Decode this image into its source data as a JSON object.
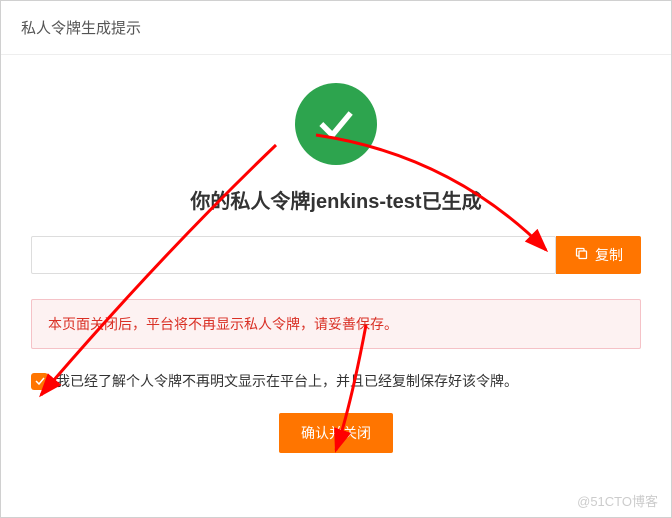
{
  "header": {
    "title": "私人令牌生成提示"
  },
  "main": {
    "title_prefix": "你的私人令牌",
    "token_name": "jenkins-test",
    "title_suffix": "已生成",
    "token_value": "",
    "copy_label": "复制",
    "warning": "本页面关闭后，平台将不再显示私人令牌，请妥善保存。",
    "checkbox_label": "我已经了解个人令牌不再明文显示在平台上，并且已经复制保存好该令牌。",
    "confirm_label": "确认并关闭"
  },
  "watermark": "@51CTO博客"
}
